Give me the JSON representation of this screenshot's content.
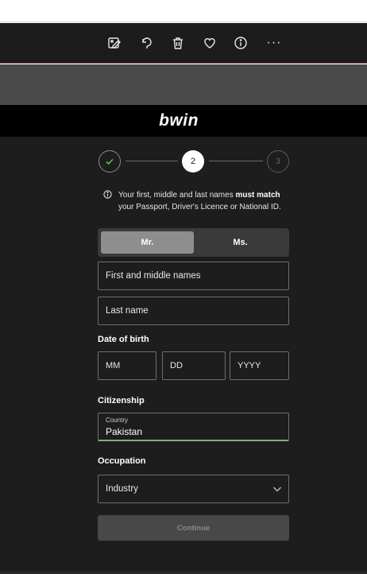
{
  "viewer": {
    "icons": [
      "edit-image-icon",
      "rotate-icon",
      "trash-icon",
      "heart-icon",
      "info-icon",
      "more-icon"
    ],
    "more_label": "···"
  },
  "brand": {
    "name": "bwin"
  },
  "stepper": {
    "steps": [
      {
        "label": "✓",
        "state": "done"
      },
      {
        "label": "2",
        "state": "current"
      },
      {
        "label": "3",
        "state": "upcoming"
      }
    ]
  },
  "info": {
    "line1_pre": "Your first, middle and last names ",
    "line1_bold": "must match",
    "line2": "your Passport, Driver's Licence or National ID."
  },
  "gender": {
    "options": [
      "Mr.",
      "Ms."
    ],
    "selected": "Mr."
  },
  "fields": {
    "first_middle": "First and middle names",
    "last": "Last name"
  },
  "dob": {
    "label": "Date of birth",
    "mm": "MM",
    "dd": "DD",
    "yyyy": "YYYY"
  },
  "citizenship": {
    "label": "Citizenship",
    "country_label": "Country",
    "country_value": "Pakistan"
  },
  "occupation": {
    "label": "Occupation",
    "value": "Industry"
  },
  "continue_label": "Continue",
  "colors": {
    "accent_green": "#5fc34a",
    "toolbar_border": "#b23a3a"
  }
}
